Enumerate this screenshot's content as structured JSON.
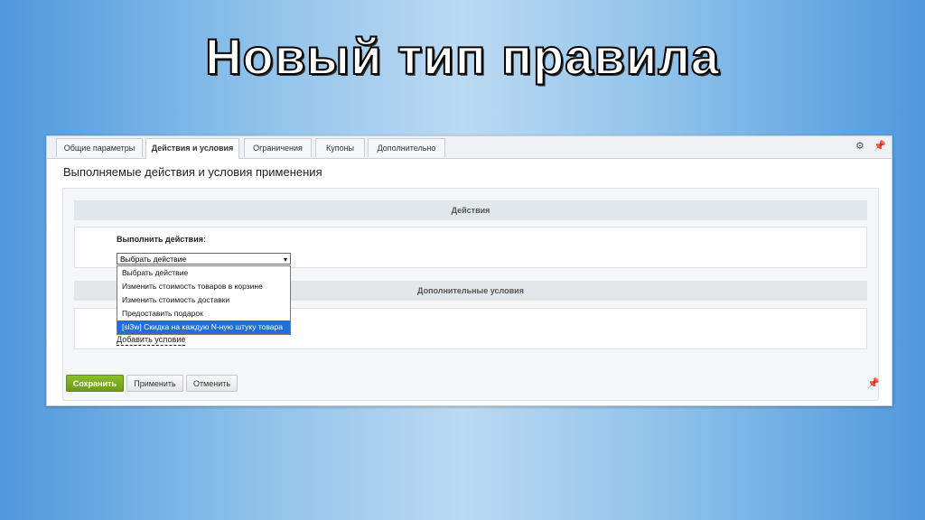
{
  "slide": {
    "title": "Новый тип правила"
  },
  "tabs": [
    {
      "label": "Общие параметры"
    },
    {
      "label": "Действия и условия"
    },
    {
      "label": "Ограничения"
    },
    {
      "label": "Купоны"
    },
    {
      "label": "Дополнительно"
    }
  ],
  "tab_icons": {
    "settings": "gear-icon",
    "pin": "pin-icon"
  },
  "section": {
    "title": "Выполняемые действия и условия применения"
  },
  "actions": {
    "header": "Действия",
    "field_label": "Выполнить действия:",
    "select_value": "Выбрать действие",
    "options": [
      "Выбрать действие",
      "Изменить стоимость товаров в корзине",
      "Изменить стоимость доставки",
      "Предоставить подарок",
      "[sl3w] Скидка на каждую N-ную штуку товара"
    ]
  },
  "conditions": {
    "header": "Дополнительные условия",
    "add_link": "Добавить условие"
  },
  "buttons": {
    "save": "Сохранить",
    "apply": "Применить",
    "cancel": "Отменить"
  },
  "colors": {
    "save_button": "#7aad22",
    "highlight": "#1e6fd9"
  }
}
